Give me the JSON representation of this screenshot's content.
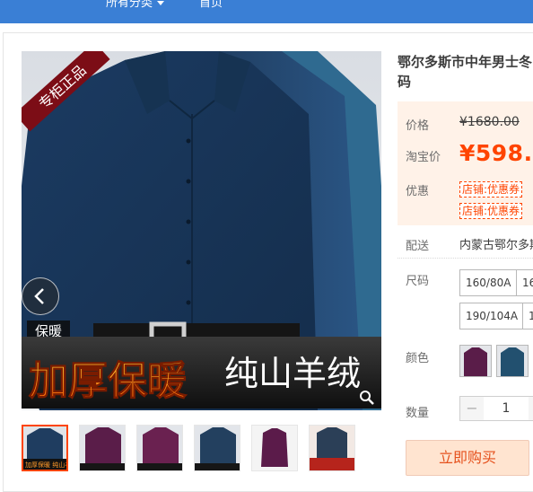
{
  "topnav": {
    "all_categories": "所有分类",
    "home": "首页"
  },
  "gallery": {
    "corner_tag": "专柜正品",
    "side_tag": "保暖",
    "banner_red": "加厚保暖",
    "banner_white": "纯山羊绒",
    "thumbs": [
      {
        "color": "#223d5c",
        "active": true
      },
      {
        "color": "#5a1d49",
        "active": false
      },
      {
        "color": "#6a2150",
        "active": false
      },
      {
        "color": "#23405f",
        "active": false
      },
      {
        "color": "#5b1b4a",
        "active": false
      },
      {
        "color": "#b6241c",
        "active": false
      }
    ],
    "thumb_first_caption": "加厚保暖 纯山羊绒"
  },
  "product": {
    "title_line1": "鄂尔多斯市中年男士冬",
    "title_line2": "码",
    "price_label": "价格",
    "original_price": "¥1680.00",
    "taobao_label": "淘宝价",
    "taobao_price": "¥598.",
    "promo_label": "优惠",
    "coupon1": "店铺:优惠券",
    "coupon2": "店铺:优惠券",
    "ship_label": "配送",
    "ship_value": "内蒙古鄂尔多斯",
    "size_label": "尺码",
    "sizes": [
      "160/80A",
      "16",
      "190/104A",
      "1"
    ],
    "color_label": "颜色",
    "qty_label": "数量",
    "qty_value": "1",
    "qty_minus": "−",
    "buy_label": "立即购买"
  },
  "colors": {
    "accent": "#ff4400",
    "topbar": "#3a7fd5",
    "price_bg": "#fff2e8",
    "buy_bg": "#ffe4d0"
  }
}
